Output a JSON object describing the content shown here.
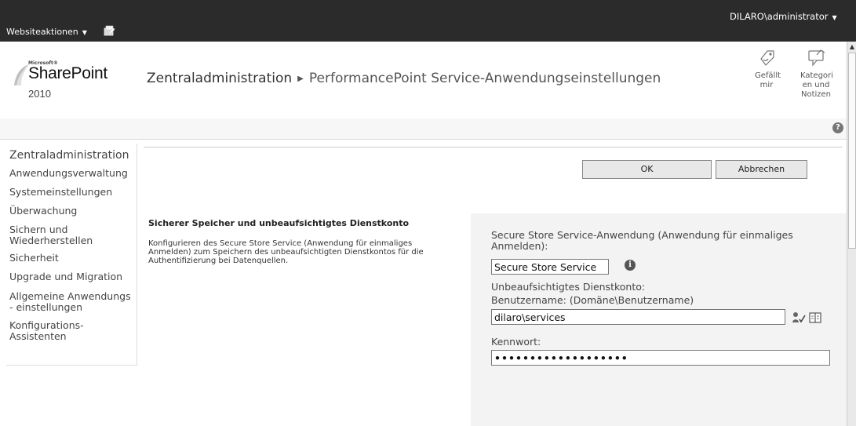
{
  "topbar": {
    "site_actions": "Websiteaktionen",
    "user": "DILARO\\administrator"
  },
  "header": {
    "logo_ms": "Microsoft®",
    "logo_product": "SharePoint",
    "logo_year": "2010",
    "breadcrumb_root": "Zentraladministration",
    "breadcrumb_current": "PerformancePoint Service-Anwendungseinstellungen",
    "like_label": "Gefällt mir",
    "tags_label": "Kategori en und Notizen"
  },
  "quicklaunch": {
    "heading": "Zentraladministration",
    "items": [
      "Anwendungsverwaltung",
      "Systemeinstellungen",
      "Überwachung",
      "Sichern und Wiederherstellen",
      "Sicherheit",
      "Upgrade und Migration",
      "Allgemeine Anwendungs - einstellungen",
      "Konfigurations- Assistenten"
    ]
  },
  "buttons": {
    "ok": "OK",
    "cancel": "Abbrechen"
  },
  "section": {
    "title": "Sicherer Speicher und unbeaufsichtigtes Dienstkonto",
    "description": "Konfigurieren des Secure Store Service (Anwendung für einmaliges Anmelden) zum Speichern des unbeaufsichtigten Dienstkontos für die Authentifizierung bei Datenquellen."
  },
  "form": {
    "sss_label": "Secure Store Service-Anwendung (Anwendung für einmaliges Anmelden):",
    "sss_value": "Secure Store Service",
    "account_label": "Unbeaufsichtigtes Dienstkonto:",
    "username_label": "Benutzername: (Domäne\\Benutzername)",
    "username_value": "dilaro\\services",
    "password_label": "Kennwort:",
    "password_value": "•••••••••••••••••••"
  },
  "colors": {
    "topbar_bg": "#2b2b2b",
    "form_panel_bg": "#f3f3f3"
  }
}
